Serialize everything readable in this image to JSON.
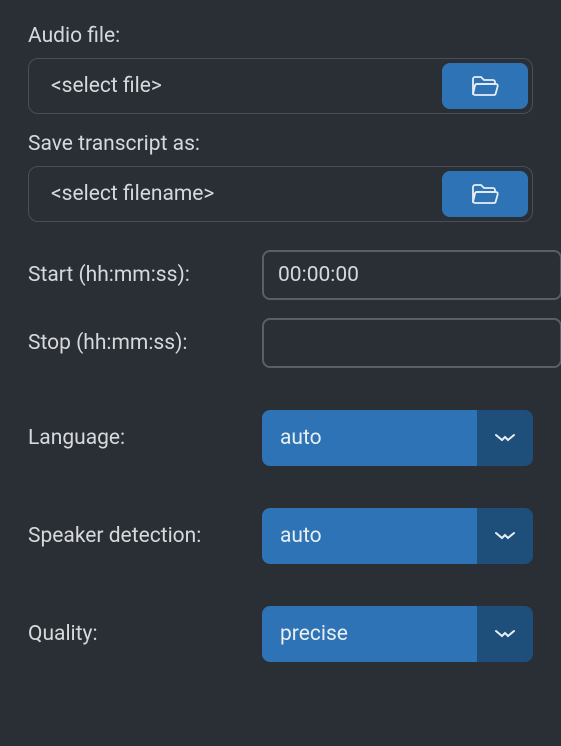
{
  "audio_file": {
    "label": "Audio file:",
    "value": "<select file>"
  },
  "save_transcript": {
    "label": "Save transcript as:",
    "value": "<select filename>"
  },
  "start": {
    "label": "Start (hh:mm:ss):",
    "value": "00:00:00"
  },
  "stop": {
    "label": "Stop (hh:mm:ss):",
    "value": ""
  },
  "language": {
    "label": "Language:",
    "selected": "auto"
  },
  "speaker_detection": {
    "label": "Speaker detection:",
    "selected": "auto"
  },
  "quality": {
    "label": "Quality:",
    "selected": "precise"
  }
}
